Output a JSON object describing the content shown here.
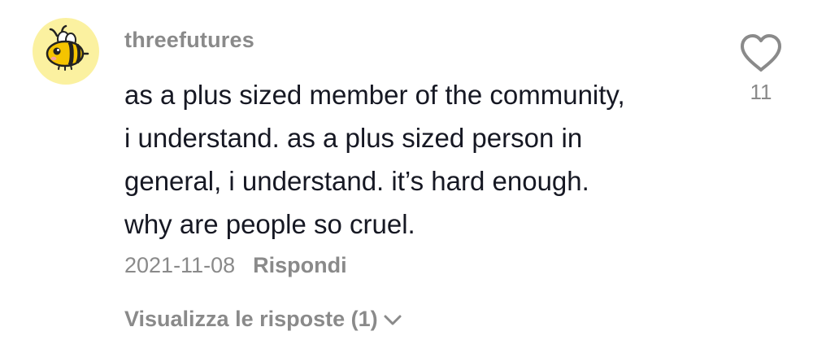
{
  "comment": {
    "username": "threefutures",
    "text_lines": [
      "as a plus sized member of the community,",
      "i understand. as a plus sized person in",
      "general, i understand. it’s hard enough.",
      "why are people so cruel."
    ],
    "date": "2021-11-08",
    "reply_label": "Rispondi",
    "view_replies_label": "Visualizza le risposte (1)",
    "like_count": "11",
    "avatar_icon": "bee-avatar-icon",
    "like_icon": "heart-outline-icon",
    "chevron_icon": "chevron-down-icon"
  },
  "colors": {
    "text_primary": "#161823",
    "text_secondary": "#8a8a8a",
    "avatar_bg": "#fbf1a0",
    "bee_body": "#f5c400"
  }
}
